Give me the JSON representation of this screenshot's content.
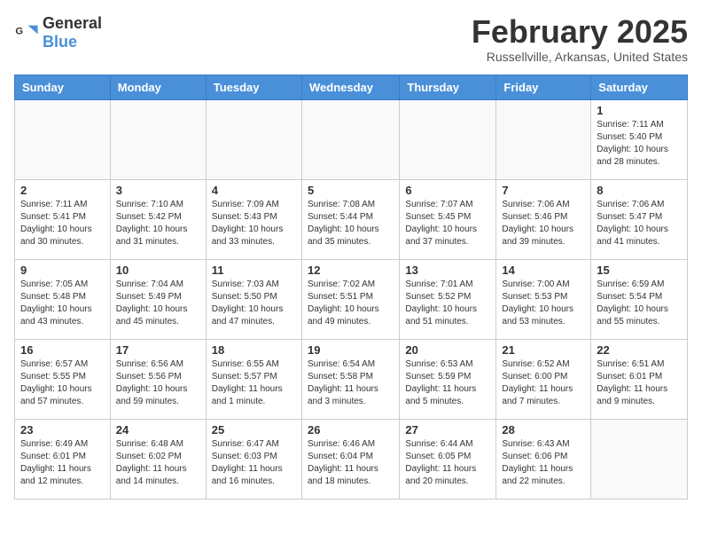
{
  "header": {
    "logo_general": "General",
    "logo_blue": "Blue",
    "month_title": "February 2025",
    "location": "Russellville, Arkansas, United States"
  },
  "weekdays": [
    "Sunday",
    "Monday",
    "Tuesday",
    "Wednesday",
    "Thursday",
    "Friday",
    "Saturday"
  ],
  "weeks": [
    [
      {
        "day": "",
        "info": ""
      },
      {
        "day": "",
        "info": ""
      },
      {
        "day": "",
        "info": ""
      },
      {
        "day": "",
        "info": ""
      },
      {
        "day": "",
        "info": ""
      },
      {
        "day": "",
        "info": ""
      },
      {
        "day": "1",
        "info": "Sunrise: 7:11 AM\nSunset: 5:40 PM\nDaylight: 10 hours and 28 minutes."
      }
    ],
    [
      {
        "day": "2",
        "info": "Sunrise: 7:11 AM\nSunset: 5:41 PM\nDaylight: 10 hours and 30 minutes."
      },
      {
        "day": "3",
        "info": "Sunrise: 7:10 AM\nSunset: 5:42 PM\nDaylight: 10 hours and 31 minutes."
      },
      {
        "day": "4",
        "info": "Sunrise: 7:09 AM\nSunset: 5:43 PM\nDaylight: 10 hours and 33 minutes."
      },
      {
        "day": "5",
        "info": "Sunrise: 7:08 AM\nSunset: 5:44 PM\nDaylight: 10 hours and 35 minutes."
      },
      {
        "day": "6",
        "info": "Sunrise: 7:07 AM\nSunset: 5:45 PM\nDaylight: 10 hours and 37 minutes."
      },
      {
        "day": "7",
        "info": "Sunrise: 7:06 AM\nSunset: 5:46 PM\nDaylight: 10 hours and 39 minutes."
      },
      {
        "day": "8",
        "info": "Sunrise: 7:06 AM\nSunset: 5:47 PM\nDaylight: 10 hours and 41 minutes."
      }
    ],
    [
      {
        "day": "9",
        "info": "Sunrise: 7:05 AM\nSunset: 5:48 PM\nDaylight: 10 hours and 43 minutes."
      },
      {
        "day": "10",
        "info": "Sunrise: 7:04 AM\nSunset: 5:49 PM\nDaylight: 10 hours and 45 minutes."
      },
      {
        "day": "11",
        "info": "Sunrise: 7:03 AM\nSunset: 5:50 PM\nDaylight: 10 hours and 47 minutes."
      },
      {
        "day": "12",
        "info": "Sunrise: 7:02 AM\nSunset: 5:51 PM\nDaylight: 10 hours and 49 minutes."
      },
      {
        "day": "13",
        "info": "Sunrise: 7:01 AM\nSunset: 5:52 PM\nDaylight: 10 hours and 51 minutes."
      },
      {
        "day": "14",
        "info": "Sunrise: 7:00 AM\nSunset: 5:53 PM\nDaylight: 10 hours and 53 minutes."
      },
      {
        "day": "15",
        "info": "Sunrise: 6:59 AM\nSunset: 5:54 PM\nDaylight: 10 hours and 55 minutes."
      }
    ],
    [
      {
        "day": "16",
        "info": "Sunrise: 6:57 AM\nSunset: 5:55 PM\nDaylight: 10 hours and 57 minutes."
      },
      {
        "day": "17",
        "info": "Sunrise: 6:56 AM\nSunset: 5:56 PM\nDaylight: 10 hours and 59 minutes."
      },
      {
        "day": "18",
        "info": "Sunrise: 6:55 AM\nSunset: 5:57 PM\nDaylight: 11 hours and 1 minute."
      },
      {
        "day": "19",
        "info": "Sunrise: 6:54 AM\nSunset: 5:58 PM\nDaylight: 11 hours and 3 minutes."
      },
      {
        "day": "20",
        "info": "Sunrise: 6:53 AM\nSunset: 5:59 PM\nDaylight: 11 hours and 5 minutes."
      },
      {
        "day": "21",
        "info": "Sunrise: 6:52 AM\nSunset: 6:00 PM\nDaylight: 11 hours and 7 minutes."
      },
      {
        "day": "22",
        "info": "Sunrise: 6:51 AM\nSunset: 6:01 PM\nDaylight: 11 hours and 9 minutes."
      }
    ],
    [
      {
        "day": "23",
        "info": "Sunrise: 6:49 AM\nSunset: 6:01 PM\nDaylight: 11 hours and 12 minutes."
      },
      {
        "day": "24",
        "info": "Sunrise: 6:48 AM\nSunset: 6:02 PM\nDaylight: 11 hours and 14 minutes."
      },
      {
        "day": "25",
        "info": "Sunrise: 6:47 AM\nSunset: 6:03 PM\nDaylight: 11 hours and 16 minutes."
      },
      {
        "day": "26",
        "info": "Sunrise: 6:46 AM\nSunset: 6:04 PM\nDaylight: 11 hours and 18 minutes."
      },
      {
        "day": "27",
        "info": "Sunrise: 6:44 AM\nSunset: 6:05 PM\nDaylight: 11 hours and 20 minutes."
      },
      {
        "day": "28",
        "info": "Sunrise: 6:43 AM\nSunset: 6:06 PM\nDaylight: 11 hours and 22 minutes."
      },
      {
        "day": "",
        "info": ""
      }
    ]
  ]
}
